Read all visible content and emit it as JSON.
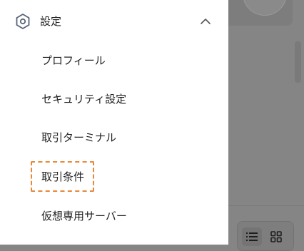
{
  "settings": {
    "title": "設定",
    "icon": "hexagon-settings-icon",
    "expanded": true,
    "items": [
      {
        "label": "プロフィール"
      },
      {
        "label": "セキュリティ設定"
      },
      {
        "label": "取引ターミナル"
      },
      {
        "label": "取引条件",
        "highlighted": true
      },
      {
        "label": "仮想専用サーバー"
      }
    ]
  },
  "view_toggle": {
    "options": [
      "list-view-icon",
      "grid-view-icon"
    ],
    "selected": "list-view-icon"
  },
  "colors": {
    "highlight": "#e6893a",
    "drawer_bg": "#ffffff",
    "backdrop": "#858585"
  }
}
